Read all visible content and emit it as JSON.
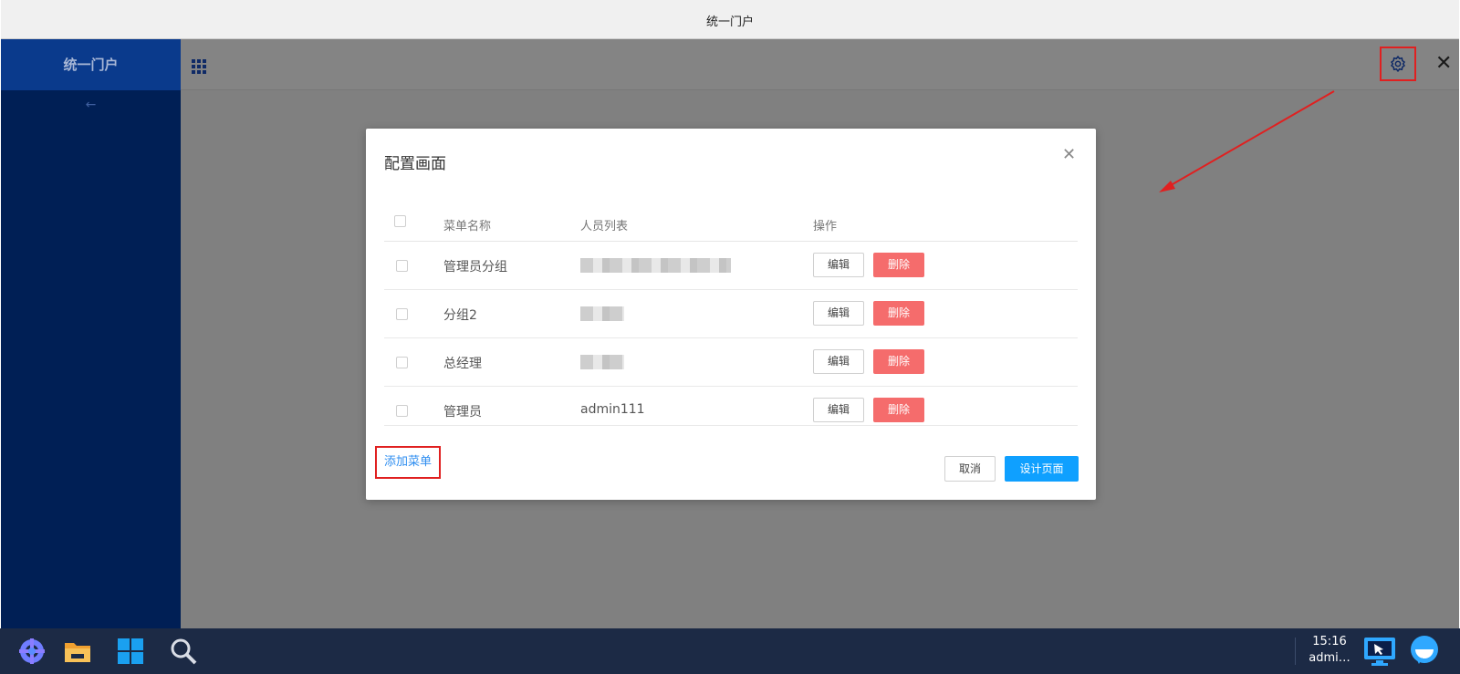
{
  "window": {
    "title": "统一门户"
  },
  "sidebar": {
    "logo": "统一门户",
    "back": "←"
  },
  "header": {
    "apps_icon": "grid-icon",
    "settings_icon": "gear-icon",
    "close_icon": "close-icon",
    "close_glyph": "✕"
  },
  "modal": {
    "title": "配置画面",
    "close_glyph": "✕",
    "columns": [
      "菜单名称",
      "人员列表",
      "操作"
    ],
    "rows": [
      {
        "name": "管理员分组",
        "users": "",
        "edit": "编辑",
        "delete": "删除"
      },
      {
        "name": "分组2",
        "users": "",
        "edit": "编辑",
        "delete": "删除"
      },
      {
        "name": "总经理",
        "users": "",
        "edit": "编辑",
        "delete": "删除"
      },
      {
        "name": "管理员",
        "users": "admin111",
        "edit": "编辑",
        "delete": "删除"
      }
    ],
    "add_menu": "添加菜单",
    "cancel": "取消",
    "design_page": "设计页面"
  },
  "taskbar": {
    "time": "15:16",
    "user": "admi…",
    "icons": [
      "app-launcher-icon",
      "file-manager-icon",
      "windows-icon",
      "search-icon",
      "remote-desktop-icon",
      "chat-icon"
    ]
  },
  "colors": {
    "sidebar": "#001f55",
    "accent": "#0fa0ff",
    "danger": "#f56c6c",
    "highlight": "#e02020"
  }
}
